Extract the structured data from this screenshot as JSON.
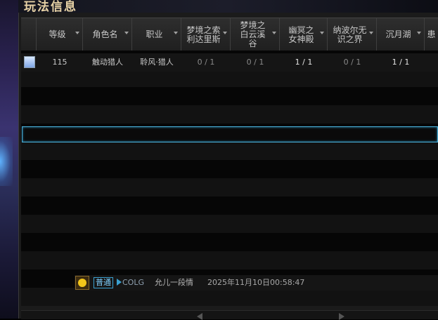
{
  "window": {
    "title": "玩法信息"
  },
  "columns": [
    {
      "label": "等级"
    },
    {
      "label": "角色名"
    },
    {
      "label": "职业"
    },
    {
      "label": "梦境之索利达里斯"
    },
    {
      "label": "梦境之白云溪谷"
    },
    {
      "label": "幽冥之女神殿"
    },
    {
      "label": "纳波尔无识之界"
    },
    {
      "label": "沉月湖"
    },
    {
      "label": "患"
    }
  ],
  "rows": [
    {
      "level": "115",
      "name": "触动猎人",
      "job": "聆风·猎人",
      "c1": "0 / 1",
      "c2": "0 / 1",
      "c3": "1 / 1",
      "c4": "0 / 1",
      "c5": "1 / 1"
    }
  ],
  "chat": {
    "channel": "普通",
    "server": "COLG",
    "user": "允儿一段情",
    "timestamp": "2025年11月10日00:58:47"
  },
  "colors": {
    "title": "#e7d2a6",
    "highlight": "#4ab0d8"
  }
}
